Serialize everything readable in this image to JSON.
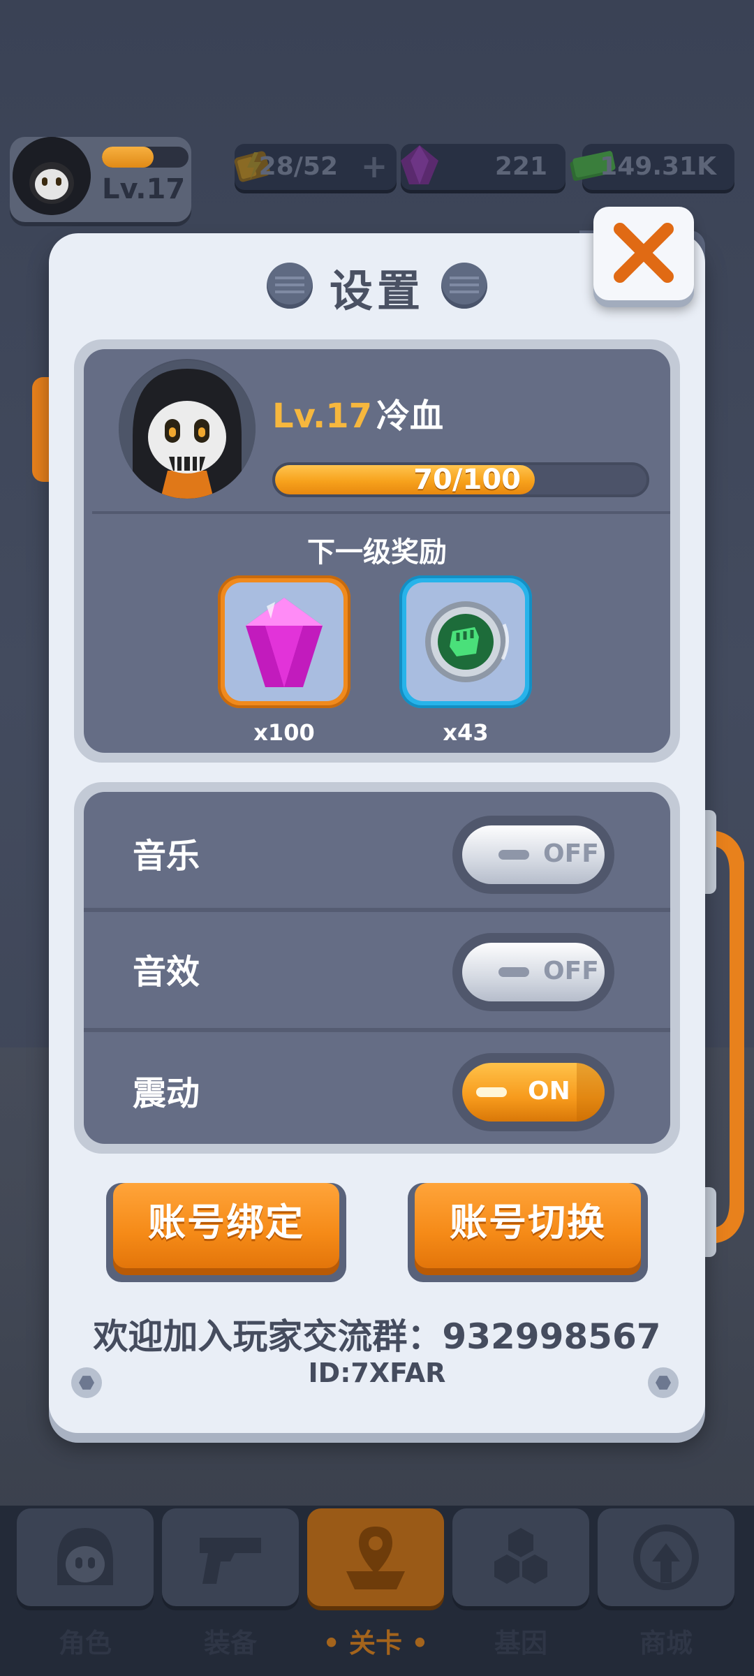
{
  "hud": {
    "player_level": "Lv.17",
    "xp_fraction": 0.6,
    "energy": "28/52",
    "gems": "221",
    "cash": "149.31K"
  },
  "dialog": {
    "title": "设置",
    "profile": {
      "level": "Lv.17",
      "name": "冷血",
      "xp_text": "70/100",
      "xp_current": 70,
      "xp_max": 100
    },
    "reward": {
      "title": "下一级奖励",
      "items": [
        {
          "icon": "purple-gem-icon",
          "qty": "x100"
        },
        {
          "icon": "green-fist-coin-icon",
          "qty": "x43"
        }
      ]
    },
    "settings": [
      {
        "label": "音乐",
        "state": "OFF"
      },
      {
        "label": "音效",
        "state": "OFF"
      },
      {
        "label": "震动",
        "state": "ON"
      }
    ],
    "buttons": {
      "bind_account": "账号绑定",
      "switch_account": "账号切换"
    },
    "footer": {
      "group": "欢迎加入玩家交流群：932998567",
      "id": "ID:7XFAR"
    }
  },
  "nav": {
    "items": [
      {
        "label": "角色",
        "icon": "skull-icon"
      },
      {
        "label": "装备",
        "icon": "gun-icon"
      },
      {
        "label": "• 关卡 •",
        "icon": "map-pin-icon"
      },
      {
        "label": "基因",
        "icon": "hexagon-cluster-icon"
      },
      {
        "label": "商城",
        "icon": "shop-icon"
      }
    ],
    "active_index": 2
  },
  "colors": {
    "accent_orange": "#f58a17",
    "gold_text": "#f6b73e",
    "panel_dark": "#656d85",
    "dialog_bg": "#e9eef6"
  }
}
